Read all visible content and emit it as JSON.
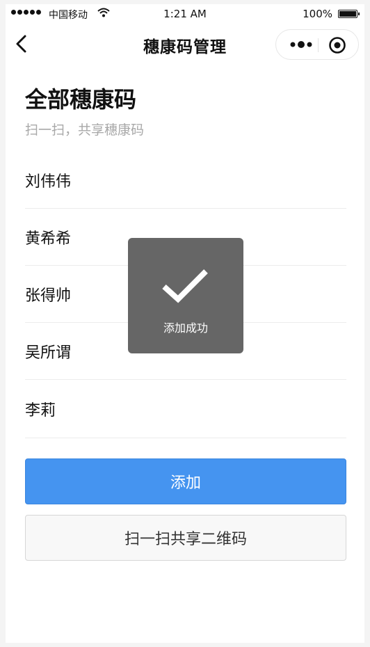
{
  "status_bar": {
    "carrier": "中国移动",
    "time": "1:21 AM",
    "battery": "100%",
    "icons": [
      "signal-dots-icon",
      "wifi-icon",
      "battery-icon"
    ]
  },
  "nav": {
    "title": "穗康码管理",
    "icons": [
      "back-chevron-icon",
      "more-dots-icon",
      "close-target-icon"
    ]
  },
  "header": {
    "title": "全部穗康码",
    "subtitle": "扫一扫，共享穗康码"
  },
  "people": [
    "刘伟伟",
    "黄希希",
    "张得帅",
    "吴所谓",
    "李莉"
  ],
  "buttons": {
    "add": "添加",
    "scan_share": "扫一扫共享二维码"
  },
  "toast": {
    "message": "添加成功",
    "icon": "checkmark-icon"
  },
  "colors": {
    "primary": "#4594f0",
    "toast_bg": "#666666",
    "subtitle": "#a8a8a8"
  }
}
